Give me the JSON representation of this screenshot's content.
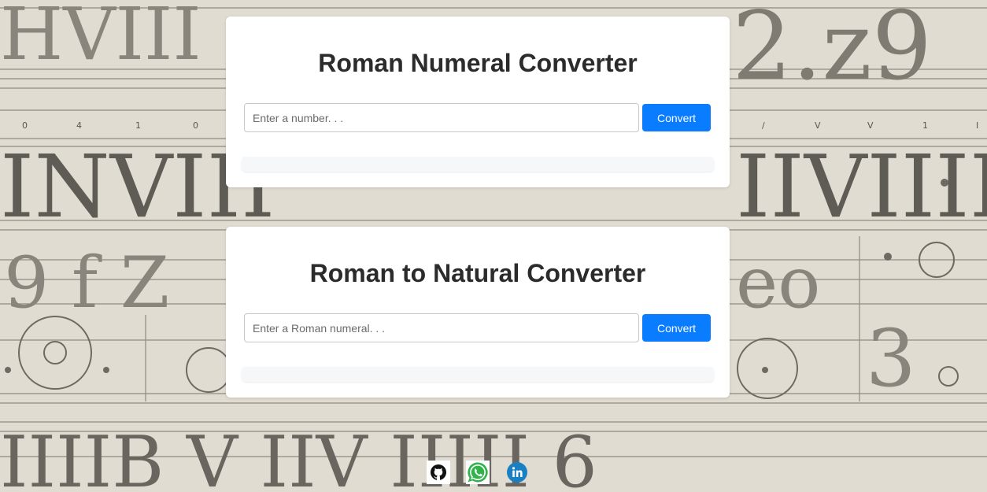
{
  "converters": [
    {
      "title": "Roman Numeral Converter",
      "input_placeholder": "Enter a number. . .",
      "button_label": "Convert",
      "result": ""
    },
    {
      "title": "Roman to Natural Converter",
      "input_placeholder": "Enter a Roman numeral. . .",
      "button_label": "Convert",
      "result": ""
    }
  ],
  "footer": {
    "links": [
      {
        "icon": "github-icon"
      },
      {
        "icon": "whatsapp-icon"
      },
      {
        "icon": "linkedin-icon"
      }
    ]
  },
  "colors": {
    "accent": "#0a7cff",
    "background": "#e2ddd2",
    "card": "#ffffff"
  }
}
